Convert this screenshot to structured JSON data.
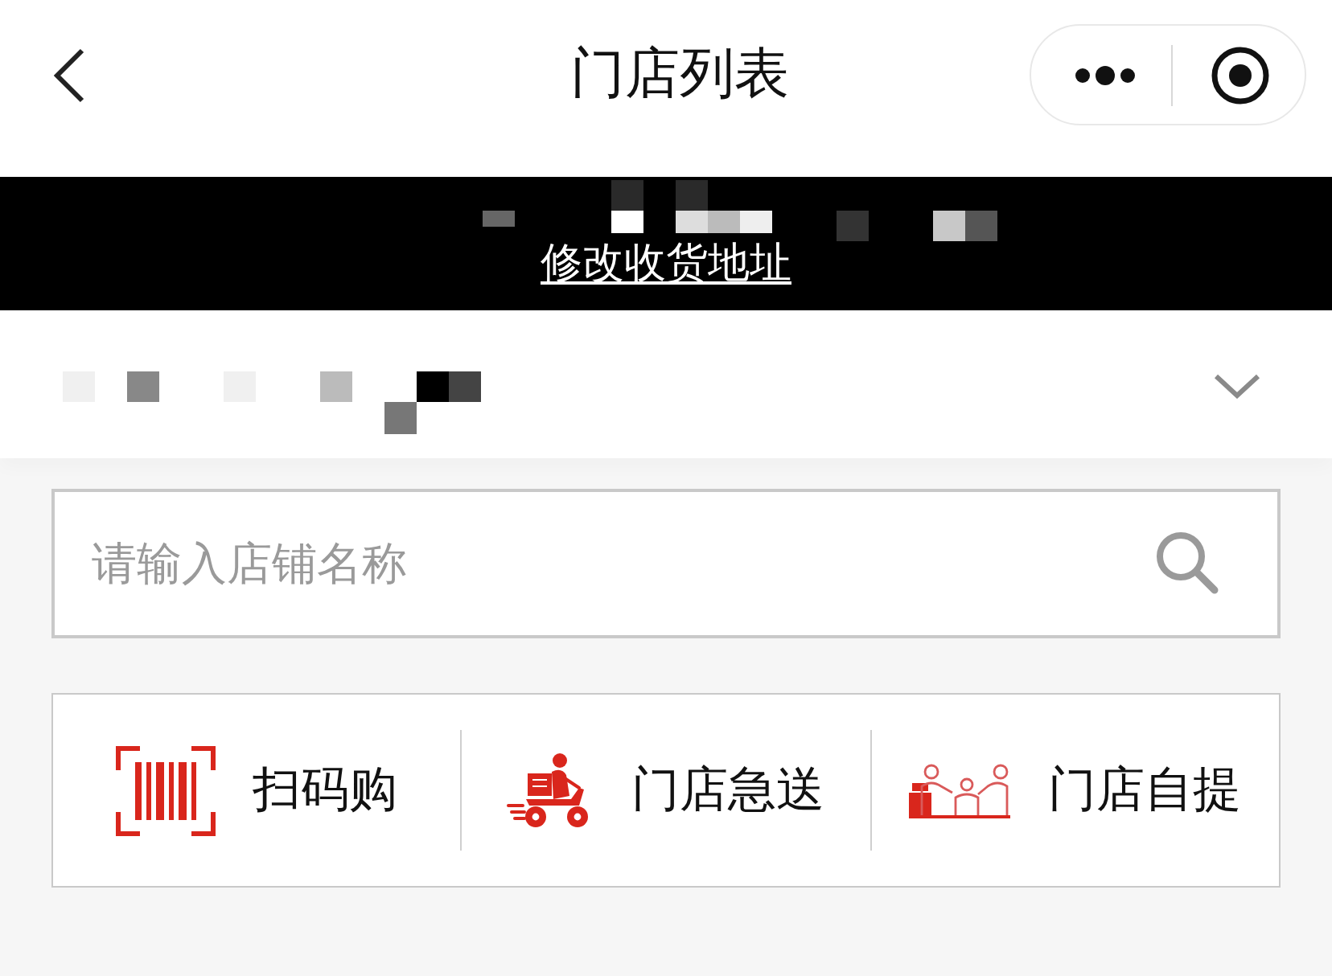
{
  "nav": {
    "title": "门店列表"
  },
  "banner": {
    "link": "修改收货地址"
  },
  "address_row": {
    "expanded": false
  },
  "search": {
    "placeholder": "请输入店铺名称"
  },
  "shortcuts": [
    {
      "kind": "scan",
      "label": "扫码购"
    },
    {
      "kind": "delivery",
      "label": "门店急送"
    },
    {
      "kind": "pickup",
      "label": "门店自提"
    }
  ]
}
